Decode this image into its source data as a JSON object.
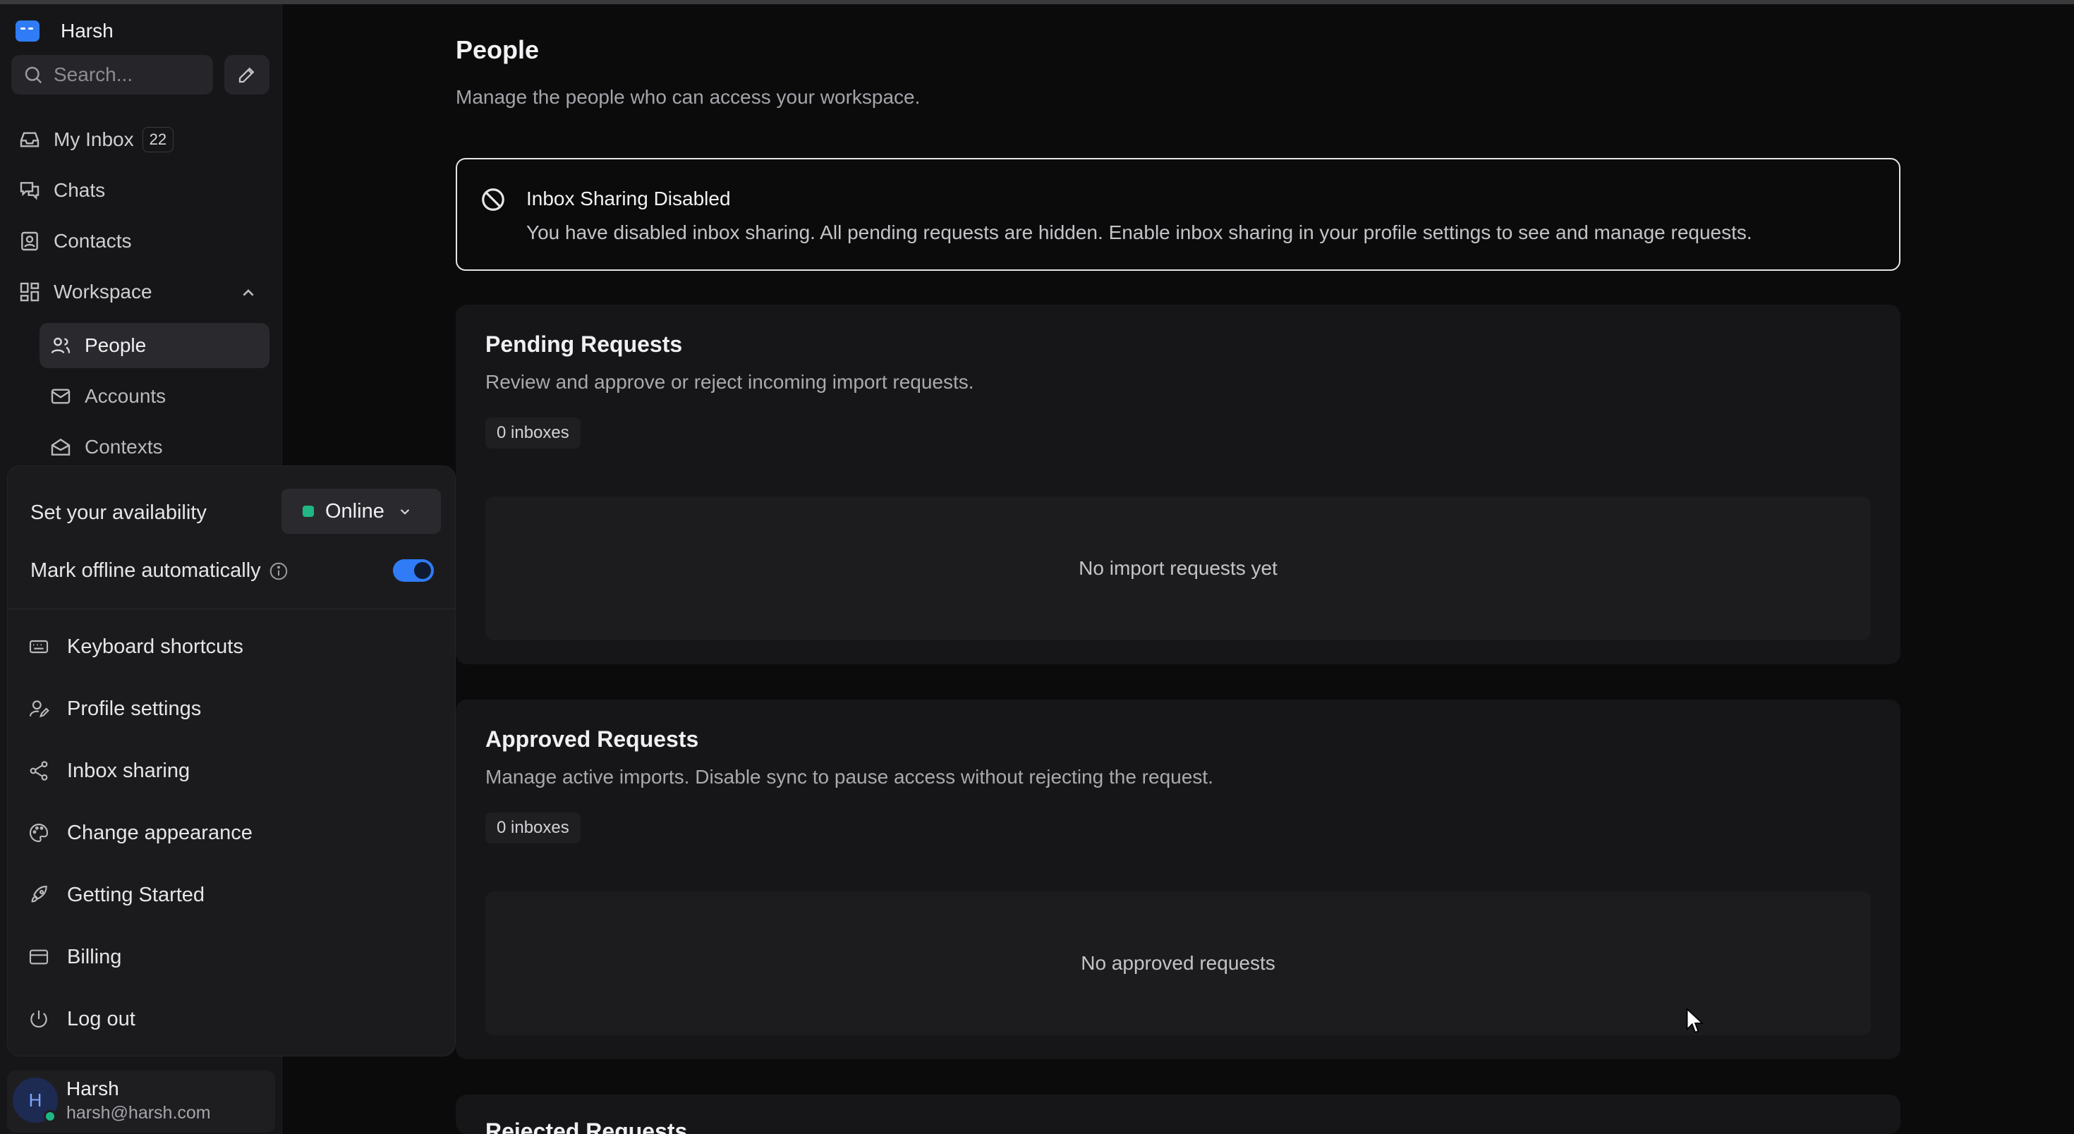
{
  "sidebar": {
    "brand": "Harsh",
    "search_placeholder": "Search...",
    "nav": [
      {
        "label": "My Inbox",
        "badge": "22"
      },
      {
        "label": "Chats"
      },
      {
        "label": "Contacts"
      },
      {
        "label": "Workspace"
      }
    ],
    "workspace_items": [
      {
        "label": "People"
      },
      {
        "label": "Accounts"
      },
      {
        "label": "Contexts"
      }
    ]
  },
  "menu": {
    "availability_label": "Set your availability",
    "availability_value": "Online",
    "auto_offline_label": "Mark offline automatically",
    "auto_offline_on": true,
    "items": [
      {
        "label": "Keyboard shortcuts",
        "icon": "keyboard-icon"
      },
      {
        "label": "Profile settings",
        "icon": "user-edit-icon"
      },
      {
        "label": "Inbox sharing",
        "icon": "share-icon"
      },
      {
        "label": "Change appearance",
        "icon": "palette-icon"
      },
      {
        "label": "Getting Started",
        "icon": "rocket-icon"
      },
      {
        "label": "Billing",
        "icon": "credit-card-icon"
      },
      {
        "label": "Log out",
        "icon": "power-icon"
      }
    ]
  },
  "user": {
    "initial": "H",
    "name": "Harsh",
    "email": "harsh@harsh.com"
  },
  "main": {
    "title": "People",
    "subtitle": "Manage the people who can access your workspace.",
    "alert": {
      "title": "Inbox Sharing Disabled",
      "text": "You have disabled inbox sharing. All pending requests are hidden. Enable inbox sharing in your profile settings to see and manage requests."
    },
    "pending": {
      "title": "Pending Requests",
      "description": "Review and approve or reject incoming import requests.",
      "count": "0 inboxes",
      "empty": "No import requests yet"
    },
    "approved": {
      "title": "Approved Requests",
      "description": "Manage active imports. Disable sync to pause access without rejecting the request.",
      "count": "0 inboxes",
      "empty": "No approved requests"
    },
    "rejected": {
      "title": "Rejected Requests"
    }
  },
  "colors": {
    "accent": "#2f7cf6",
    "online": "#1fb885"
  }
}
